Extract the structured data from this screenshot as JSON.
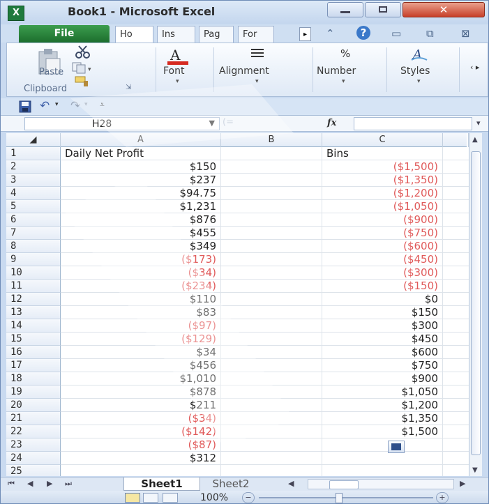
{
  "window": {
    "title": "Book1 - Microsoft Excel",
    "app_icon_letter": "X",
    "close_glyph": "✕"
  },
  "ribbon_tabs": {
    "file": "File",
    "home": "Ho",
    "insert": "Ins",
    "page": "Pag",
    "formulas": "For",
    "scroll_glyph": "▸"
  },
  "ribbon": {
    "paste_label": "Paste",
    "clipboard_label": "Clipboard",
    "font_label": "Font",
    "alignment_label": "Alignment",
    "number_label": "Number",
    "number_icon": "%",
    "styles_label": "Styles"
  },
  "formula_bar": {
    "name_box": "H28",
    "fx_label": "fx",
    "formula_value": ""
  },
  "grid": {
    "columns": [
      "A",
      "B",
      "C"
    ],
    "rows": [
      {
        "n": "1",
        "a": "Daily Net Profit",
        "c": "Bins"
      },
      {
        "n": "2",
        "a": "$150",
        "c": "($1,500)"
      },
      {
        "n": "3",
        "a": "$237",
        "c": "($1,350)"
      },
      {
        "n": "4",
        "a": "$94.75",
        "c": "($1,200)"
      },
      {
        "n": "5",
        "a": "$1,231",
        "c": "($1,050)"
      },
      {
        "n": "6",
        "a": "$876",
        "c": "($900)"
      },
      {
        "n": "7",
        "a": "$455",
        "c": "($750)"
      },
      {
        "n": "8",
        "a": "$349",
        "c": "($600)"
      },
      {
        "n": "9",
        "a": "($173)",
        "c": "($450)"
      },
      {
        "n": "10",
        "a": "($34)",
        "c": "($300)"
      },
      {
        "n": "11",
        "a": "($234)",
        "c": "($150)"
      },
      {
        "n": "12",
        "a": "$110",
        "c": "$0"
      },
      {
        "n": "13",
        "a": "$83",
        "c": "$150"
      },
      {
        "n": "14",
        "a": "($97)",
        "c": "$300"
      },
      {
        "n": "15",
        "a": "($129)",
        "c": "$450"
      },
      {
        "n": "16",
        "a": "$34",
        "c": "$600"
      },
      {
        "n": "17",
        "a": "$456",
        "c": "$750"
      },
      {
        "n": "18",
        "a": "$1,010",
        "c": "$900"
      },
      {
        "n": "19",
        "a": "$878",
        "c": "$1,050"
      },
      {
        "n": "20",
        "a": "$211",
        "c": "$1,200"
      },
      {
        "n": "21",
        "a": "($34)",
        "c": "$1,350"
      },
      {
        "n": "22",
        "a": "($142)",
        "c": "$1,500"
      },
      {
        "n": "23",
        "a": "($87)",
        "c": ""
      },
      {
        "n": "24",
        "a": "$312",
        "c": ""
      },
      {
        "n": "25",
        "a": "",
        "c": ""
      }
    ]
  },
  "sheets": {
    "sheet1": "Sheet1",
    "sheet2": "Sheet2"
  },
  "status": {
    "zoom": "100%",
    "zoom_minus": "−",
    "zoom_plus": "+"
  },
  "colors": {
    "negative": "#e05a5a",
    "file_tab": "#2e8a40",
    "close_button": "#c8402a"
  }
}
